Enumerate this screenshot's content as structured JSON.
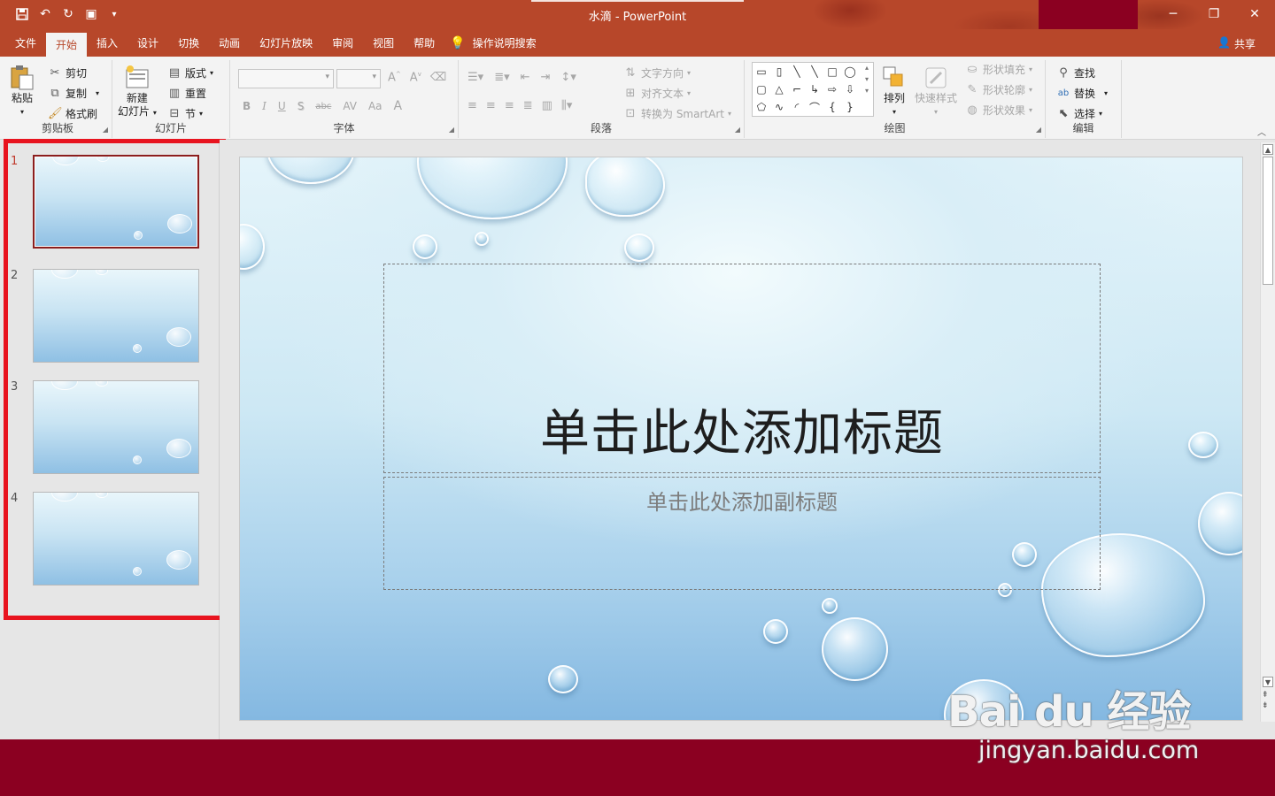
{
  "window": {
    "title": "水滴 - PowerPoint",
    "accent_color": "#b7472a",
    "status_bar_color": "#8b0021",
    "controls": [
      "minimize-icon",
      "restore-icon",
      "close-icon"
    ]
  },
  "quick_access": [
    "save-icon",
    "undo-icon",
    "redo-icon",
    "present-icon",
    "customize-icon"
  ],
  "menu": {
    "tabs": [
      "文件",
      "开始",
      "插入",
      "设计",
      "切换",
      "动画",
      "幻灯片放映",
      "审阅",
      "视图",
      "帮助"
    ],
    "active_tab": "开始",
    "tell_me": "操作说明搜索",
    "share": "共享"
  },
  "ribbon": {
    "clipboard": {
      "label": "剪贴板",
      "paste": "粘贴",
      "cut": "剪切",
      "copy": "复制",
      "format_painter": "格式刷"
    },
    "slides": {
      "label": "幻灯片",
      "new_slide_line1": "新建",
      "new_slide_line2": "幻灯片",
      "layout": "版式",
      "reset": "重置",
      "section": "节"
    },
    "font": {
      "label": "字体",
      "bold": "B",
      "italic": "I",
      "underline": "U",
      "shadow": "S",
      "strike": "abc",
      "spacing": "AV",
      "case": "Aa",
      "color": "A"
    },
    "paragraph": {
      "label": "段落",
      "text_direction": "文字方向",
      "align_text": "对齐文本",
      "smartart": "转换为 SmartArt"
    },
    "drawing": {
      "label": "绘图",
      "arrange": "排列",
      "quick_styles": "快速样式",
      "shape_fill": "形状填充",
      "shape_outline": "形状轮廓",
      "shape_effects": "形状效果"
    },
    "editing": {
      "label": "编辑",
      "find": "查找",
      "replace": "替换",
      "select": "选择"
    }
  },
  "thumbnails": [
    {
      "number": "1",
      "selected": true
    },
    {
      "number": "2",
      "selected": false
    },
    {
      "number": "3",
      "selected": false
    },
    {
      "number": "4",
      "selected": false
    }
  ],
  "slide": {
    "title_placeholder": "单击此处添加标题",
    "subtitle_placeholder": "单击此处添加副标题",
    "theme": "water-droplets"
  },
  "watermark": {
    "logo": "Bai du 经验",
    "url": "jingyan.baidu.com"
  },
  "highlight_color": "#e8141f"
}
